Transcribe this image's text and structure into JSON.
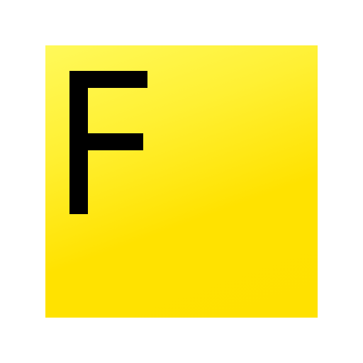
{
  "icon": {
    "letter": "F",
    "name": "letter-f-icon",
    "background_color_light": "#fff95a",
    "background_color_dark": "#ffe100",
    "letter_color": "#000000"
  }
}
